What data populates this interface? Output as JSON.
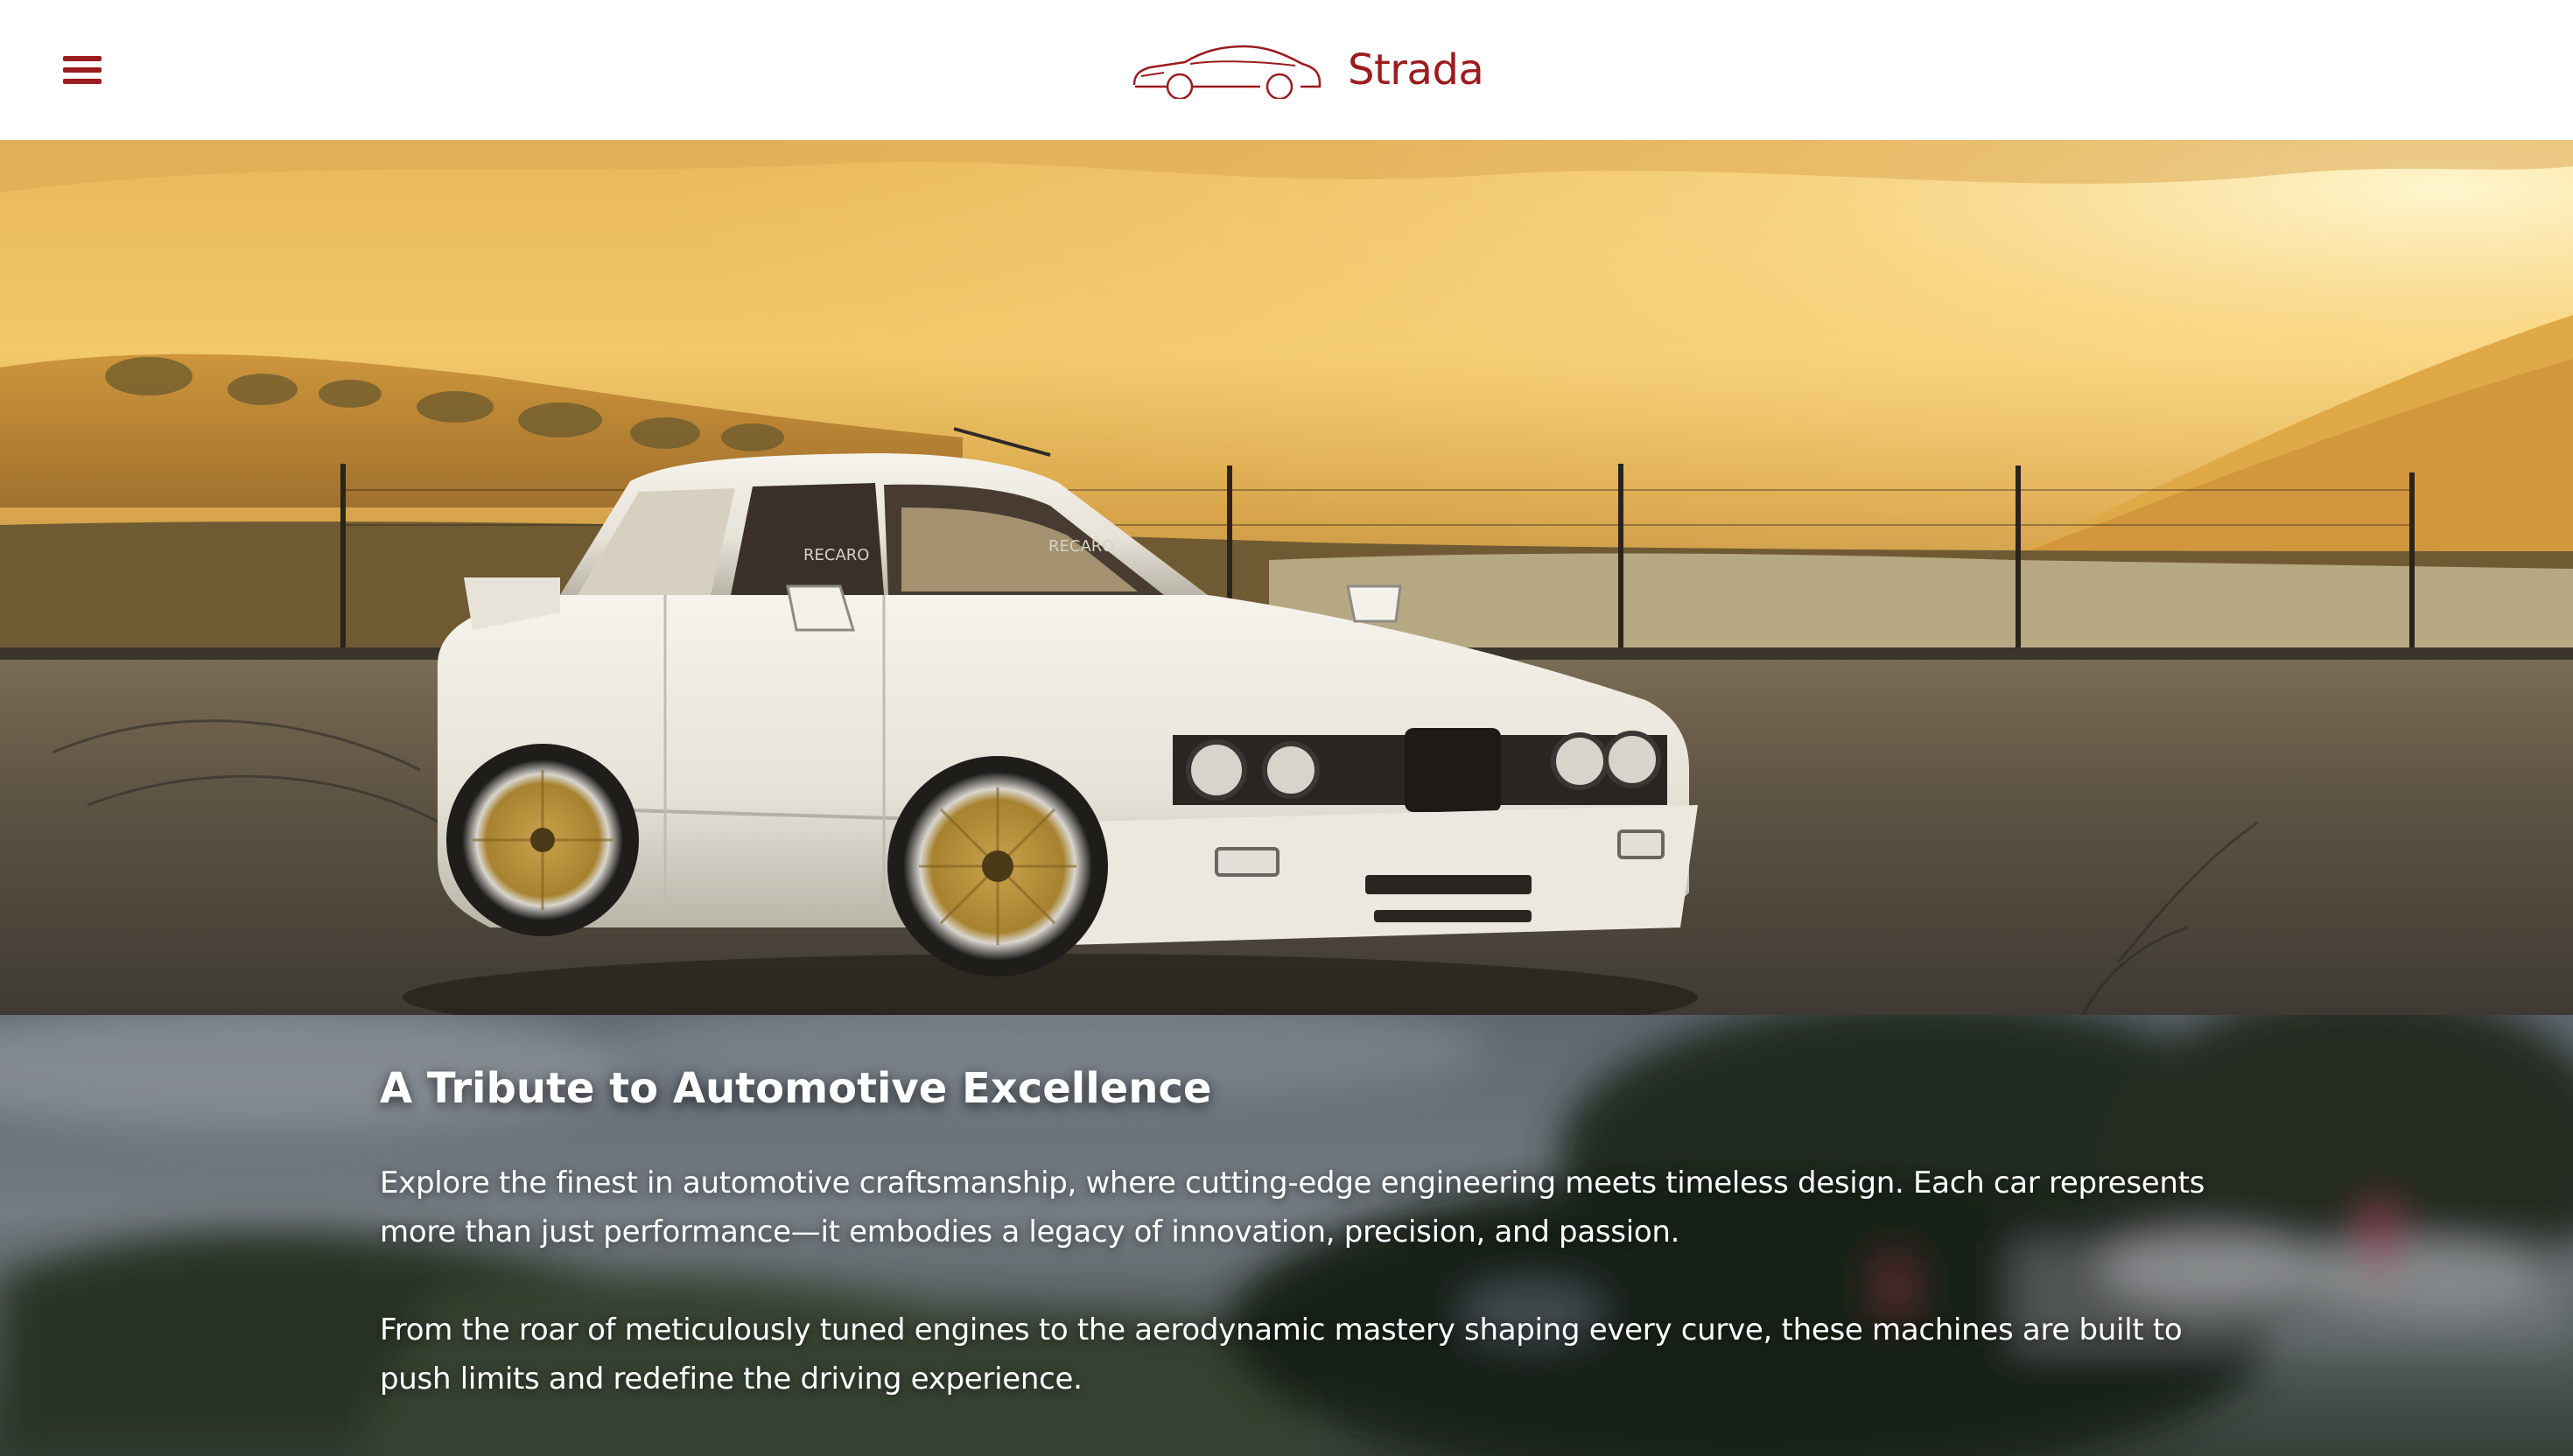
{
  "header": {
    "brand_name": "Strada",
    "menu_icon": "hamburger-menu-icon",
    "logo_icon": "car-outline-logo-icon",
    "brand_color": "#9b1c1f"
  },
  "hero": {
    "image_label": "RECARO"
  },
  "tribute": {
    "title": "A Tribute to Automotive Excellence",
    "paragraphs": [
      "Explore the finest in automotive craftsmanship, where cutting-edge engineering meets timeless design. Each car represents more than just performance—it embodies a legacy of innovation, precision, and passion.",
      "From the roar of meticulously tuned engines to the aerodynamic mastery shaping every curve, these machines are built to push limits and redefine the driving experience."
    ]
  },
  "colors": {
    "accent": "#9b1c1f",
    "text_on_dark": "#ffffff"
  }
}
